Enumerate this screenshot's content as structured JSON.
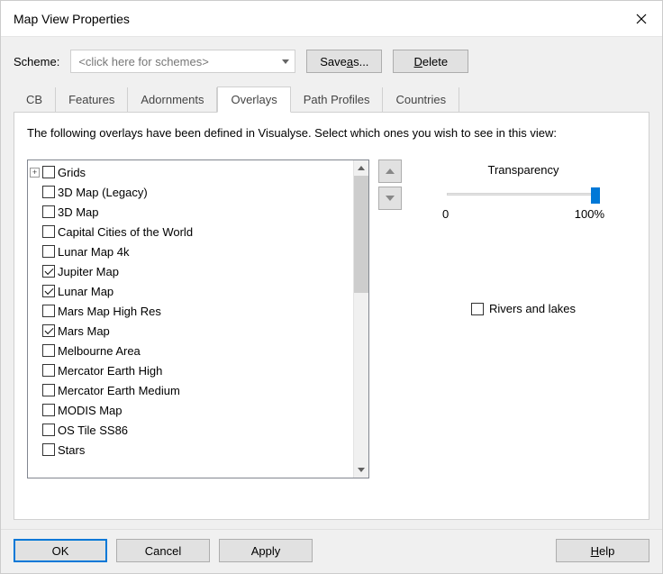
{
  "window": {
    "title": "Map View Properties"
  },
  "scheme": {
    "label": "Scheme:",
    "placeholder": "<click here for schemes>",
    "save_label": "Save as...",
    "delete_label": "Delete",
    "save_accel": "a",
    "delete_accel": "D"
  },
  "tabs": [
    "CB",
    "Features",
    "Adornments",
    "Overlays",
    "Path Profiles",
    "Countries"
  ],
  "active_tab": "Overlays",
  "intro": "The following overlays have been defined in Visualyse. Select which ones you wish to see in this view:",
  "overlays": [
    {
      "label": "Grids",
      "checked": false,
      "expandable": true
    },
    {
      "label": "3D Map (Legacy)",
      "checked": false
    },
    {
      "label": "3D Map",
      "checked": false
    },
    {
      "label": "Capital Cities of the World",
      "checked": false
    },
    {
      "label": "Lunar Map 4k",
      "checked": false
    },
    {
      "label": "Jupiter Map",
      "checked": true
    },
    {
      "label": "Lunar Map",
      "checked": true
    },
    {
      "label": "Mars Map High Res",
      "checked": false
    },
    {
      "label": "Mars Map",
      "checked": true
    },
    {
      "label": "Melbourne Area",
      "checked": false
    },
    {
      "label": "Mercator Earth High",
      "checked": false
    },
    {
      "label": "Mercator Earth Medium",
      "checked": false
    },
    {
      "label": "MODIS Map",
      "checked": false
    },
    {
      "label": "OS Tile SS86",
      "checked": false
    },
    {
      "label": "Stars",
      "checked": false
    }
  ],
  "transparency": {
    "label": "Transparency",
    "min_label": "0",
    "max_label": "100%",
    "value": 100
  },
  "rivers": {
    "label": "Rivers and lakes",
    "checked": false
  },
  "buttons": {
    "ok": "OK",
    "cancel": "Cancel",
    "apply": "Apply",
    "help": "Help"
  }
}
